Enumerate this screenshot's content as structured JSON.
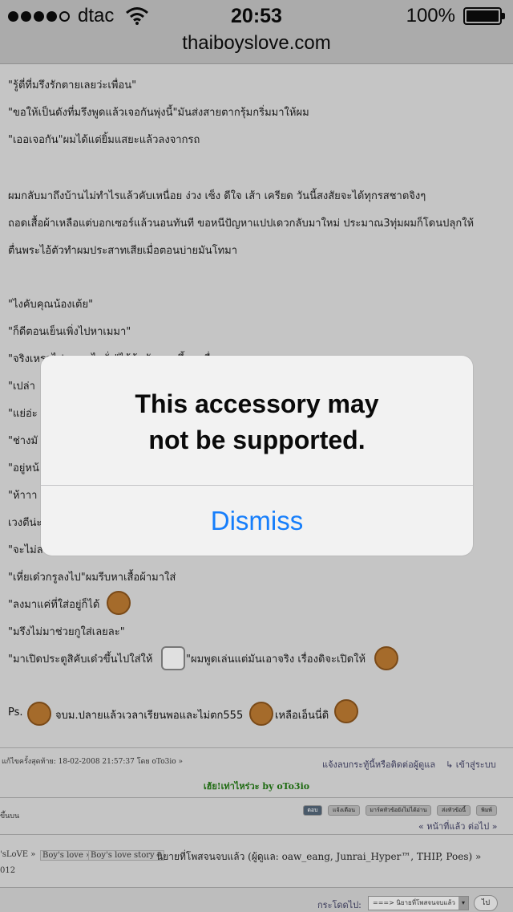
{
  "status_bar": {
    "carrier": "dtac",
    "time": "20:53",
    "battery": "100%",
    "signal_bars": 4,
    "signal_max": 5
  },
  "url": "thaiboyslove.com",
  "story_lines": [
    "\"รู้ตี่ที่มรึงรักตายเลยว่ะเพื่อน\"",
    "\"ขอให้เป็นดังที่มรึงพูดแล้วเจอกันพุ่งนี้\"มันส่งสายตากรุ้มกริ่มมาให้ผม",
    "\"เออเจอกัน\"ผมได้แต่ยิ้มแสยะแล้วลงจากรถ",
    "ผมกลับมาถึงบ้านไม่ทำไรแล้วคับเหนื่อย ง่วง เซ็ง ดีใจ เส้า เครียด วันนี้สงสัยจะได้ทุกรสชาตจิงๆ",
    "ถอดเสื้อผ้าเหลือแต่บอกเซอร์แล้วนอนทันที ขอหนีปัญหาแปปเดวกลับมาใหม่ ประมาณ3ทุ่มผมก็โดนปลุกให้",
    "ตื่นพระไอ้ตัวทำผมประสาทเสียเมื่อตอนบ่ายมันโทมา",
    "\"ไงคับคุณน้องเต้ย\"",
    "\"ก็ดีตอนเย็นเพิ่งไปหาเมมา\"",
    "\"จริงเหรอไปเจออะไรมั่ง\"ไอ้ต้อมันถามขึ้นมาตื่อ",
    "\"เปล่า",
    "\"แย่อ่ะ",
    "\"ช่างมั",
    "\"อยู่หน้",
    "\"ห้าาา",
    "เวงตีน่ะ",
    "\"จะไม่ล",
    "\"เหี่ยเด๋วกรูลงไป\"ผมรีบหาเสื้อผ้ามาใส่",
    "\"ลงมาแค่ที่ใส่อยู่ก็ได้",
    "\"มรึงไม่มาช่วยกูใส่เลยละ\"",
    "\"มาเปิดประตูสิคับเด๋วขึ้นไปใส่ให้",
    "\"ผมพูดเล่นแต่มันเอาจริง เรื่องดิจะเปิดให้"
  ],
  "ps_line": {
    "prefix": "Ps.",
    "middle": "จบม.ปลายแล้วเวลาเรียนพอและไม่ตก555",
    "suffix": "เหลือเอ็นนี่ดิ"
  },
  "footer": {
    "last_edit": "แก้ไขครั้งสุดท้าย: 18-02-2008 21:57:37 โดย oTo3io »",
    "report": "แจ้งลบกระทู้นี้หรือติดต่อผู้ดูแล",
    "login": "เข้าสู่ระบบ",
    "signature": "เฮ้ย!เท่าไหร่วะ by oTo3io",
    "top_link": "ขึ้นบน",
    "tool_buttons": [
      "ตอบ",
      "แจ้งเตือน",
      "มาร์คหัวข้อยังไม่ได้อ่าน",
      "ส่งหัวข้อนี้",
      "พิมพ์"
    ],
    "pager": "« หน้าที่แล้ว ต่อไป »",
    "breadcrumb": [
      "'sLoVE »",
      "Boy's love »",
      "Boy's love story »"
    ],
    "board_title": "นิยายที่โพสจนจบแล้ว",
    "moderators_prefix": "(ผู้ดูแล: ",
    "moderators": "oaw_eang, Junrai_Hyper™, THIP, Poes) »",
    "year": "012",
    "jump_label": "กระโดดไป:",
    "jump_select": "===> นิยายที่โพสจนจบแล้ว",
    "go_button": "ไป"
  },
  "alert": {
    "message": "This accessory may\nnot be supported.",
    "dismiss": "Dismiss",
    "button_color": "#167efb"
  }
}
